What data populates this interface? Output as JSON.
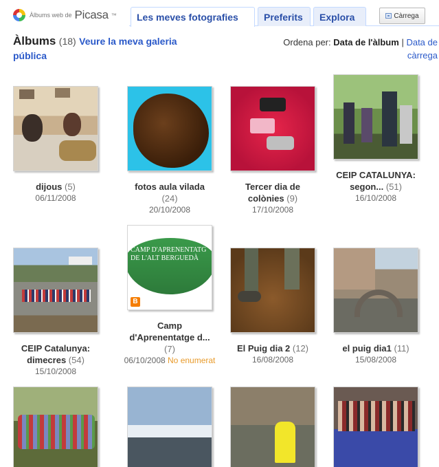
{
  "header": {
    "logo_small": "Àlbums web de",
    "logo_big": "Picasa",
    "logo_tm": "™",
    "tabs": [
      {
        "label": "Les meves fotografies",
        "active": true
      },
      {
        "label": "Preferits",
        "active": false
      },
      {
        "label": "Explora",
        "active": false
      }
    ],
    "upload_label": "Càrrega"
  },
  "heading": {
    "title": "Àlbums",
    "count": "(18)",
    "gallery_link": "Veure la meva galeria pública"
  },
  "sort": {
    "prefix": "Ordena per:",
    "active": "Data de l'àlbum",
    "separator": "|",
    "alternative": "Data de càrrega"
  },
  "albums": [
    {
      "name": "dijous",
      "count": "(5)",
      "date": "06/11/2008",
      "icon": "photo-thumbnail"
    },
    {
      "name": "fotos aula vilada",
      "count": "(24)",
      "date": "20/10/2008",
      "icon": "photo-thumbnail"
    },
    {
      "name": "Tercer dia de colònies",
      "count": "(9)",
      "date": "17/10/2008",
      "icon": "photo-thumbnail"
    },
    {
      "name": "CEIP CATALUNYA: segon...",
      "count": "(51)",
      "date": "16/10/2008",
      "icon": "photo-thumbnail"
    },
    {
      "name": "CEIP Catalunya: dimecres",
      "count": "(54)",
      "date": "15/10/2008",
      "icon": "photo-thumbnail"
    },
    {
      "name": "Camp d'Aprenentatge d...",
      "count": "(7)",
      "date": "06/10/2008",
      "flag": "No enumerat",
      "thumb_text": "CAMP D'APRENENTATG DE L'ALT BERGUEDÀ",
      "icon": "blogger-icon"
    },
    {
      "name": "El Puig dia 2",
      "count": "(12)",
      "date": "16/08/2008",
      "icon": "photo-thumbnail"
    },
    {
      "name": "el puig dia1",
      "count": "(11)",
      "date": "15/08/2008",
      "icon": "photo-thumbnail"
    }
  ],
  "colors": {
    "link": "#2a59c9",
    "tab_text": "#2a4fa8",
    "tab_bg": "#e8eefa",
    "unlisted": "#e89a2a"
  }
}
